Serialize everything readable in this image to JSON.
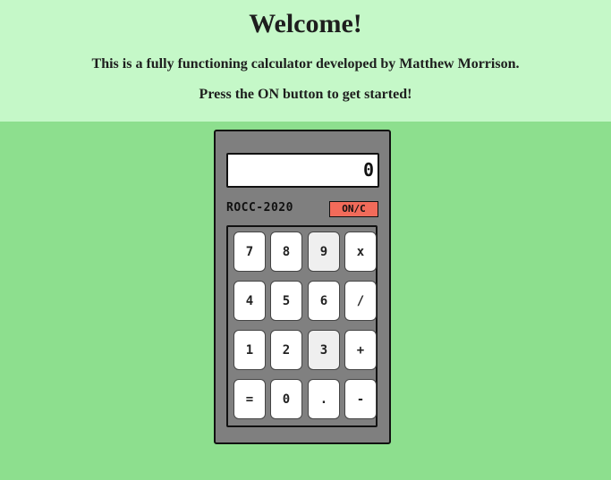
{
  "header": {
    "title": "Welcome!",
    "line1": "This is a fully functioning calculator developed by Matthew Morrison.",
    "line2": "Press the ON button to get started!"
  },
  "calculator": {
    "display": "0",
    "model": "ROCC-2020",
    "on_clear_label": "ON/C",
    "keys": [
      {
        "label": "7",
        "name": "key-7"
      },
      {
        "label": "8",
        "name": "key-8"
      },
      {
        "label": "9",
        "name": "key-9"
      },
      {
        "label": "x",
        "name": "key-multiply"
      },
      {
        "label": "4",
        "name": "key-4"
      },
      {
        "label": "5",
        "name": "key-5"
      },
      {
        "label": "6",
        "name": "key-6"
      },
      {
        "label": "/",
        "name": "key-divide"
      },
      {
        "label": "1",
        "name": "key-1"
      },
      {
        "label": "2",
        "name": "key-2"
      },
      {
        "label": "3",
        "name": "key-3"
      },
      {
        "label": "+",
        "name": "key-add"
      },
      {
        "label": "=",
        "name": "key-equals"
      },
      {
        "label": "0",
        "name": "key-0"
      },
      {
        "label": ".",
        "name": "key-decimal"
      },
      {
        "label": "-",
        "name": "key-subtract"
      }
    ]
  },
  "colors": {
    "background": "#8ddf8e",
    "header_background": "#c5f8c8",
    "calculator_body": "#7f7f7f",
    "on_button": "#f26b5a"
  }
}
